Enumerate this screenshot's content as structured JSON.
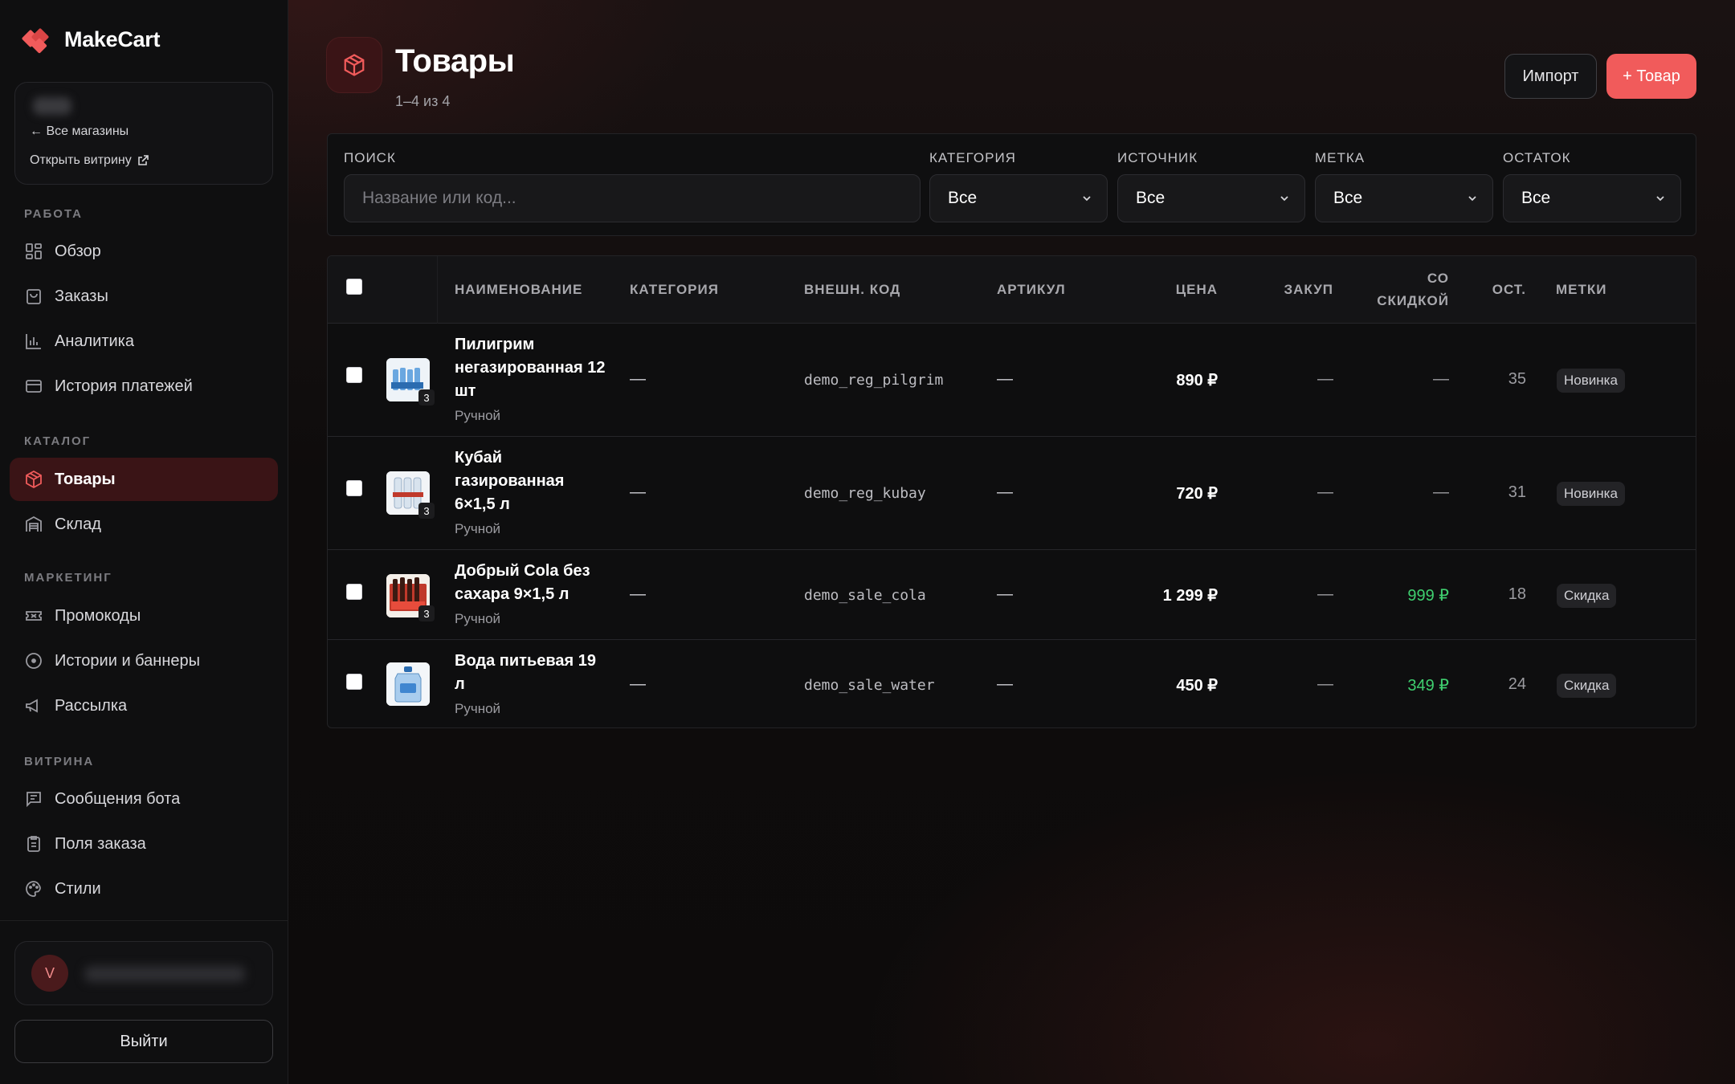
{
  "brand": {
    "name": "MakeCart"
  },
  "store": {
    "all_stores": "← Все магазины",
    "open_storefront": "Открыть витрину"
  },
  "sidebar": {
    "sections": [
      {
        "title": "РАБОТА",
        "items": [
          {
            "label": "Обзор",
            "icon": "dashboard-icon"
          },
          {
            "label": "Заказы",
            "icon": "bag-icon"
          },
          {
            "label": "Аналитика",
            "icon": "chart-icon"
          },
          {
            "label": "История платежей",
            "icon": "card-icon"
          }
        ]
      },
      {
        "title": "КАТАЛОГ",
        "items": [
          {
            "label": "Товары",
            "icon": "box-icon",
            "active": true
          },
          {
            "label": "Склад",
            "icon": "warehouse-icon"
          }
        ]
      },
      {
        "title": "МАРКЕТИНГ",
        "items": [
          {
            "label": "Промокоды",
            "icon": "ticket-icon"
          },
          {
            "label": "Истории и баннеры",
            "icon": "circle-dot-icon"
          },
          {
            "label": "Рассылка",
            "icon": "megaphone-icon"
          }
        ]
      },
      {
        "title": "ВИТРИНА",
        "items": [
          {
            "label": "Сообщения бота",
            "icon": "message-icon"
          },
          {
            "label": "Поля заказа",
            "icon": "clipboard-icon"
          },
          {
            "label": "Стили",
            "icon": "palette-icon"
          }
        ]
      }
    ]
  },
  "user": {
    "avatar_letter": "V"
  },
  "logout_label": "Выйти",
  "header": {
    "title": "Товары",
    "subtitle": "1–4 из 4",
    "import_label": "Импорт",
    "add_label": "+ Товар"
  },
  "filters": {
    "search": {
      "label": "ПОИСК",
      "placeholder": "Название или код..."
    },
    "category": {
      "label": "КАТЕГОРИЯ",
      "value": "Все"
    },
    "source": {
      "label": "ИСТОЧНИК",
      "value": "Все"
    },
    "tag": {
      "label": "МЕТКА",
      "value": "Все"
    },
    "stock": {
      "label": "ОСТАТОК",
      "value": "Все"
    }
  },
  "table": {
    "columns": {
      "name": "НАИМЕНОВАНИЕ",
      "category": "КАТЕГОРИЯ",
      "ext_code": "ВНЕШН. КОД",
      "sku": "АРТИКУЛ",
      "price": "ЦЕНА",
      "cost": "ЗАКУП",
      "discount_1": "СО",
      "discount_2": "СКИДКОЙ",
      "stock": "ОСТ.",
      "tags": "МЕТКИ"
    },
    "rows": [
      {
        "name": "Пилигрим негазированная 12 шт",
        "source": "Ручной",
        "category": "—",
        "ext_code": "demo_reg_pilgrim",
        "sku": "—",
        "price": "890 ₽",
        "cost": "—",
        "discount": "—",
        "stock": "35",
        "tag": "Новинка",
        "img_count": "3"
      },
      {
        "name": "Кубай газированная 6×1,5 л",
        "source": "Ручной",
        "category": "—",
        "ext_code": "demo_reg_kubay",
        "sku": "—",
        "price": "720 ₽",
        "cost": "—",
        "discount": "—",
        "stock": "31",
        "tag": "Новинка",
        "img_count": "3"
      },
      {
        "name": "Добрый Cola без сахара 9×1,5 л",
        "source": "Ручной",
        "category": "—",
        "ext_code": "demo_sale_cola",
        "sku": "—",
        "price": "1 299 ₽",
        "cost": "—",
        "discount": "999 ₽",
        "stock": "18",
        "tag": "Скидка",
        "img_count": "3"
      },
      {
        "name": "Вода питьевая 19 л",
        "source": "Ручной",
        "category": "—",
        "ext_code": "demo_sale_water",
        "sku": "—",
        "price": "450 ₽",
        "cost": "—",
        "discount": "349 ₽",
        "stock": "24",
        "tag": "Скидка",
        "img_count": ""
      }
    ]
  },
  "colors": {
    "accent": "#f15b5b",
    "active_nav": "#3a1416",
    "discount_green": "#3fcf6f"
  }
}
